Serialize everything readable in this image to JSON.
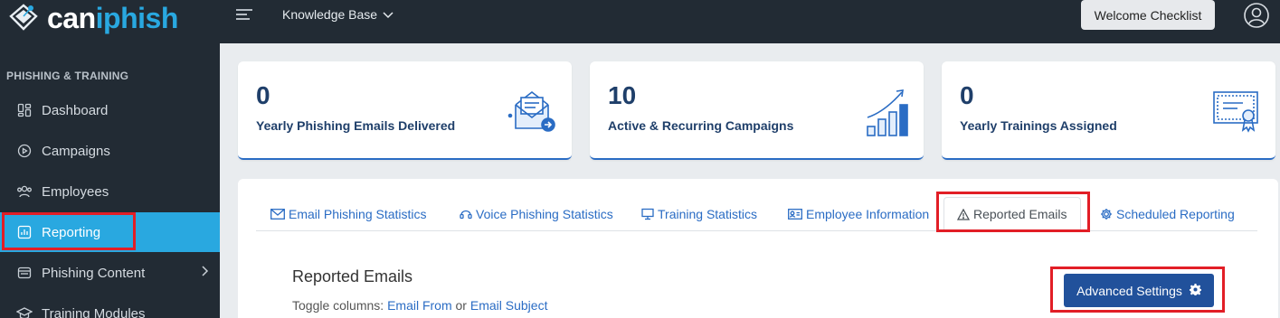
{
  "brand": {
    "name_part1": "can",
    "name_part2": "iphish"
  },
  "topbar": {
    "menu_label": "Knowledge Base",
    "welcome_button": "Welcome Checklist"
  },
  "sidebar": {
    "section_title": "PHISHING & TRAINING",
    "items": [
      {
        "label": "Dashboard",
        "icon": "dashboard-icon"
      },
      {
        "label": "Campaigns",
        "icon": "play-circle-icon"
      },
      {
        "label": "Employees",
        "icon": "users-icon"
      },
      {
        "label": "Reporting",
        "icon": "chart-icon",
        "active": true
      },
      {
        "label": "Phishing Content",
        "icon": "folder-icon",
        "has_submenu": true
      },
      {
        "label": "Training Modules",
        "icon": "graduation-cap-icon"
      }
    ]
  },
  "stats": [
    {
      "value": "0",
      "label": "Yearly Phishing Emails Delivered",
      "icon": "email-sent-illustration"
    },
    {
      "value": "10",
      "label": "Active & Recurring Campaigns",
      "icon": "growth-chart-illustration"
    },
    {
      "value": "0",
      "label": "Yearly Trainings Assigned",
      "icon": "certificate-illustration"
    }
  ],
  "tabs": [
    {
      "label": "Email Phishing Statistics",
      "icon": "envelope-icon"
    },
    {
      "label": "Voice Phishing Statistics",
      "icon": "headset-icon"
    },
    {
      "label": "Training Statistics",
      "icon": "monitor-icon"
    },
    {
      "label": "Employee Information",
      "icon": "id-card-icon"
    },
    {
      "label": "Reported Emails",
      "icon": "warning-triangle-icon",
      "active": true
    },
    {
      "label": "Scheduled Reporting",
      "icon": "gear-icon"
    }
  ],
  "reported": {
    "heading": "Reported Emails",
    "toggle_prefix": "Toggle columns: ",
    "toggle_link1": "Email From",
    "toggle_or": " or ",
    "toggle_link2": "Email Subject",
    "advanced_button": "Advanced Settings"
  },
  "colors": {
    "sidebar_bg": "#222b34",
    "accent": "#29a8e0",
    "primary": "#21519b",
    "highlight": "#e21e26"
  }
}
